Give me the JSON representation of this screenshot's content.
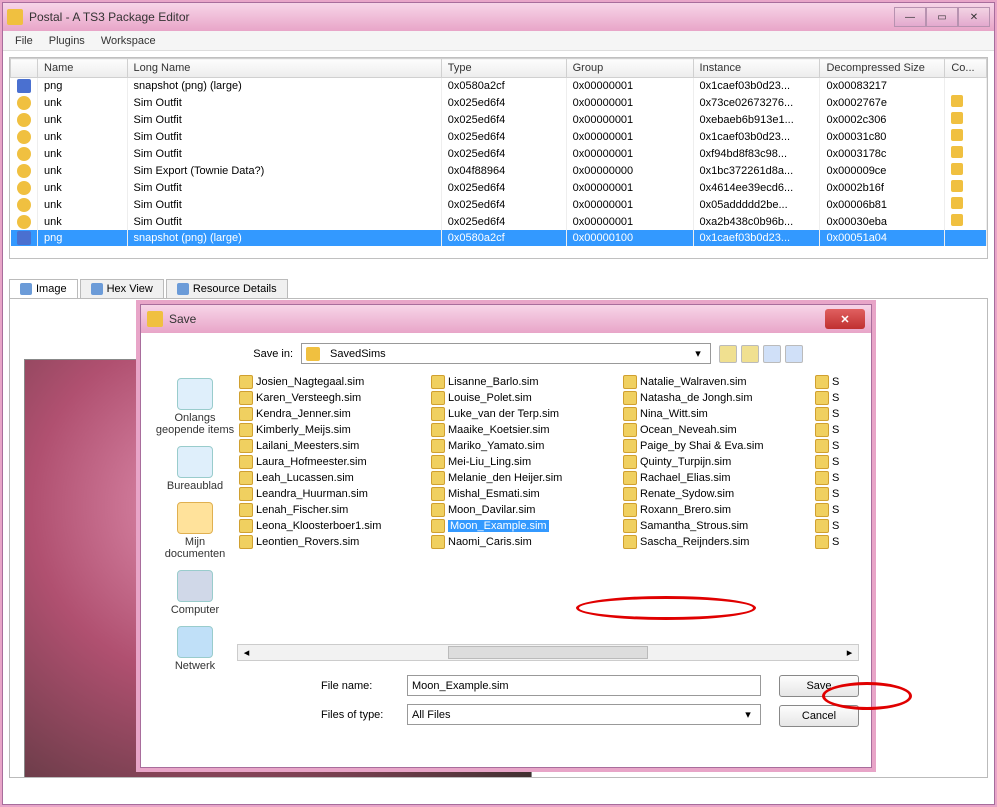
{
  "window": {
    "title": "Postal - A TS3 Package Editor",
    "menu": {
      "file": "File",
      "plugins": "Plugins",
      "workspace": "Workspace"
    }
  },
  "table": {
    "headers": {
      "name": "Name",
      "longname": "Long Name",
      "type": "Type",
      "group": "Group",
      "instance": "Instance",
      "decomp": "Decompressed Size",
      "co": "Co..."
    },
    "rows": [
      {
        "icon": "png",
        "name": "png",
        "longname": "snapshot (png) (large)",
        "type": "0x0580a2cf",
        "group": "0x00000001",
        "instance": "0x1caef03b0d23...",
        "decomp": "0x00083217",
        "c": false,
        "sel": false
      },
      {
        "icon": "unk",
        "name": "unk",
        "longname": "Sim Outfit",
        "type": "0x025ed6f4",
        "group": "0x00000001",
        "instance": "0x73ce02673276...",
        "decomp": "0x0002767e",
        "c": true,
        "sel": false
      },
      {
        "icon": "unk",
        "name": "unk",
        "longname": "Sim Outfit",
        "type": "0x025ed6f4",
        "group": "0x00000001",
        "instance": "0xebaeb6b913e1...",
        "decomp": "0x0002c306",
        "c": true,
        "sel": false
      },
      {
        "icon": "unk",
        "name": "unk",
        "longname": "Sim Outfit",
        "type": "0x025ed6f4",
        "group": "0x00000001",
        "instance": "0x1caef03b0d23...",
        "decomp": "0x00031c80",
        "c": true,
        "sel": false
      },
      {
        "icon": "unk",
        "name": "unk",
        "longname": "Sim Outfit",
        "type": "0x025ed6f4",
        "group": "0x00000001",
        "instance": "0xf94bd8f83c98...",
        "decomp": "0x0003178c",
        "c": true,
        "sel": false
      },
      {
        "icon": "unk",
        "name": "unk",
        "longname": "Sim Export (Townie Data?)",
        "type": "0x04f88964",
        "group": "0x00000000",
        "instance": "0x1bc372261d8a...",
        "decomp": "0x000009ce",
        "c": true,
        "sel": false
      },
      {
        "icon": "unk",
        "name": "unk",
        "longname": "Sim Outfit",
        "type": "0x025ed6f4",
        "group": "0x00000001",
        "instance": "0x4614ee39ecd6...",
        "decomp": "0x0002b16f",
        "c": true,
        "sel": false
      },
      {
        "icon": "unk",
        "name": "unk",
        "longname": "Sim Outfit",
        "type": "0x025ed6f4",
        "group": "0x00000001",
        "instance": "0x05addddd2be...",
        "decomp": "0x00006b81",
        "c": true,
        "sel": false
      },
      {
        "icon": "unk",
        "name": "unk",
        "longname": "Sim Outfit",
        "type": "0x025ed6f4",
        "group": "0x00000001",
        "instance": "0xa2b438c0b96b...",
        "decomp": "0x00030eba",
        "c": true,
        "sel": false
      },
      {
        "icon": "png",
        "name": "png",
        "longname": "snapshot (png) (large)",
        "type": "0x0580a2cf",
        "group": "0x00000100",
        "instance": "0x1caef03b0d23...",
        "decomp": "0x00051a04",
        "c": false,
        "sel": true
      }
    ]
  },
  "tabs": {
    "image": "Image",
    "hex": "Hex View",
    "resource": "Resource Details"
  },
  "dialog": {
    "title": "Save",
    "save_in_label": "Save in:",
    "save_in_value": "SavedSims",
    "places": {
      "recent": "Onlangs geopende items",
      "desktop": "Bureaublad",
      "mydocs": "Mijn documenten",
      "computer": "Computer",
      "network": "Netwerk"
    },
    "files": {
      "col1": [
        "Josien_Nagtegaal.sim",
        "Karen_Versteegh.sim",
        "Kendra_Jenner.sim",
        "Kimberly_Meijs.sim",
        "Lailani_Meesters.sim",
        "Laura_Hofmeester.sim",
        "Leah_Lucassen.sim",
        "Leandra_Huurman.sim",
        "Lenah_Fischer.sim",
        "Leona_Kloosterboer1.sim",
        "Leontien_Rovers.sim"
      ],
      "col2": [
        "Lisanne_Barlo.sim",
        "Louise_Polet.sim",
        "Luke_van der Terp.sim",
        "Maaike_Koetsier.sim",
        "Mariko_Yamato.sim",
        "Mei-Liu_Ling.sim",
        "Melanie_den Heijer.sim",
        "Mishal_Esmati.sim",
        "Moon_Davilar.sim",
        "Moon_Example.sim",
        "Naomi_Caris.sim"
      ],
      "col3": [
        "Natalie_Walraven.sim",
        "Natasha_de Jongh.sim",
        "Nina_Witt.sim",
        "Ocean_Neveah.sim",
        "Paige_by Shai & Eva.sim",
        "Quinty_Turpijn.sim",
        "Rachael_Elias.sim",
        "Renate_Sydow.sim",
        "Roxann_Brero.sim",
        "Samantha_Strous.sim",
        "Sascha_Reijnders.sim"
      ],
      "col4": [
        "S",
        "S",
        "S",
        "S",
        "S",
        "S",
        "S",
        "S",
        "S",
        "S",
        "S"
      ],
      "selected": "Moon_Example.sim"
    },
    "filename_label": "File name:",
    "filename_value": "Moon_Example.sim",
    "filetype_label": "Files of type:",
    "filetype_value": "All Files",
    "save": "Save",
    "cancel": "Cancel"
  }
}
